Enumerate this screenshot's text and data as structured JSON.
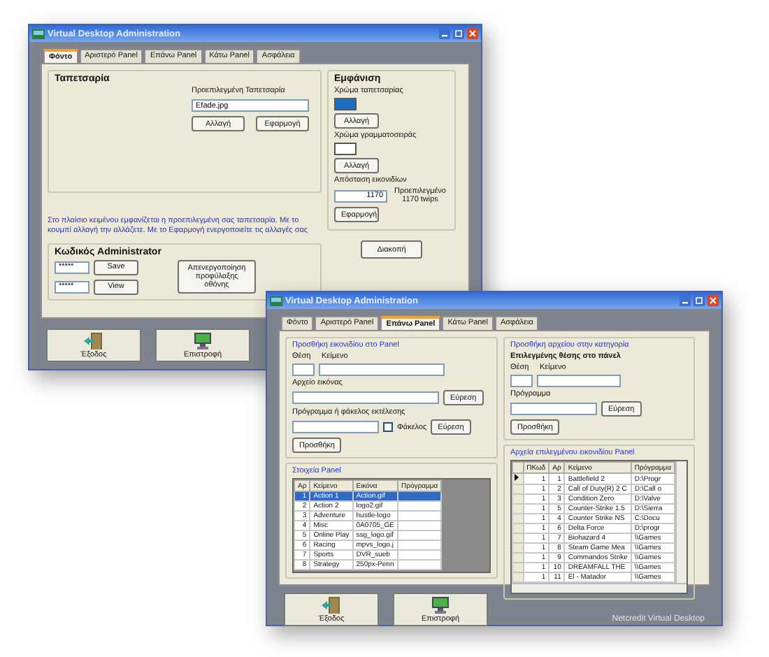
{
  "back_window": {
    "title": "Virtual Desktop Administration",
    "tabs": [
      {
        "label": "Φόντο",
        "selected": true
      },
      {
        "label": "Αριστερό Panel",
        "selected": false
      },
      {
        "label": "Επάνω Panel",
        "selected": false
      },
      {
        "label": "Κάτω Panel",
        "selected": false
      },
      {
        "label": "Ασφάλεια",
        "selected": false
      }
    ],
    "wallpaper_group": {
      "title": "Ταπετσαρία",
      "field_label": "Προεπιλεγμένη Ταπετσαρία",
      "field_value": "Efade.jpg",
      "buttons": [
        "Αλλαγή",
        "Εφαρμογή"
      ]
    },
    "note": "Στο πλαίσιο κειμένου εμφανίζεται η προεπιλεγμένη σας ταπετσαρία. Με το κουμπί αλλαγή την αλλάζετε. Με το Εφαρμογή ενεργοποιείτε τις αλλαγές σας",
    "password_group": {
      "title": "Κωδικός Administrator",
      "rows": [
        {
          "value": "*****",
          "button": "Save"
        },
        {
          "value": "*****",
          "button": "View"
        }
      ],
      "screensaver_button": "Απενεργοποίηση προφύλαξης οθόνης"
    },
    "appearance_group": {
      "title": "Εμφάνιση",
      "colors": [
        {
          "label": "Χρώμα ταπετσαρίας",
          "color": "#1a6fc4",
          "button": "Αλλαγή"
        },
        {
          "label": "Χρώμα γραμματοσειράς",
          "color": "#ffffff",
          "button": "Αλλαγή"
        }
      ],
      "spacing_label": "Απόσταση εικονιδίων",
      "spacing_value": "1170",
      "spacing_hint": "Προεπιλεγμένο 1170 twips",
      "apply_button": "Εφαρμογή"
    },
    "stop_button": "Διακοπή",
    "footer_buttons": [
      {
        "label": "Έξοδος",
        "kind": "exit"
      },
      {
        "label": "Επιστροφή",
        "kind": "return"
      }
    ]
  },
  "front_window": {
    "title": "Virtual Desktop Administration",
    "tabs": [
      {
        "label": "Φόντο",
        "selected": false
      },
      {
        "label": "Αριστερό Panel",
        "selected": false
      },
      {
        "label": "Επάνω Panel",
        "selected": true
      },
      {
        "label": "Κάτω Panel",
        "selected": false
      },
      {
        "label": "Ασφάλεια",
        "selected": false
      }
    ],
    "add_icon_group": {
      "title": "Προσθήκη εικονιδίου στο Panel",
      "position_label": "Θέση",
      "text_label": "Κείμενο",
      "image_label": "Αρχείο εικόνας",
      "image_browse_button": "Εύρεση",
      "program_label": "Πρόγραμμα ή φάκελος εκτέλεσης",
      "folder_checkbox": {
        "label": "Φάκελος",
        "checked": false
      },
      "program_browse_button": "Εύρεση",
      "add_button": "Προσθήκη"
    },
    "panel_items_group": {
      "title": "Στοιχεία Panel",
      "columns": [
        "Αρ",
        "Κείμενο",
        "Εικόνα",
        "Πρόγραμμα"
      ],
      "rows": [
        {
          "number": "1",
          "text": "Action 1",
          "image": "Action.gif",
          "selected": true
        },
        {
          "number": "2",
          "text": "Action 2",
          "image": "logo2.gif",
          "selected": false
        },
        {
          "number": "3",
          "text": "Adventure",
          "image": "hustle-logo",
          "selected": false
        },
        {
          "number": "4",
          "text": "Misc",
          "image": "0A0705_GE",
          "selected": false
        },
        {
          "number": "5",
          "text": "Online Play",
          "image": "ssg_logo.gif",
          "selected": false
        },
        {
          "number": "6",
          "text": "Racing",
          "image": "mpvs_logo.j",
          "selected": false
        },
        {
          "number": "7",
          "text": "Sports",
          "image": "DVR_sueb",
          "selected": false
        },
        {
          "number": "8",
          "text": "Strategy",
          "image": "250px-Penn",
          "selected": false
        }
      ]
    },
    "add_file_group": {
      "title": "Προσθήκη αρχείου στην κατηγορία",
      "subtitle": "Επιλεγμένης θέσης στο πάνελ",
      "position_label": "Θέση",
      "text_label": "Κείμενο",
      "program_label": "Πρόγραμμα",
      "browse_button": "Εύρεση",
      "add_button": "Προσθήκη"
    },
    "files_group": {
      "title": "Αρχεία επιλεγμένου εικονιδίου Panel",
      "columns": [
        "ΠΚωδ",
        "Αρ",
        "Κείμενο",
        "Πρόγραμμα"
      ],
      "rows": [
        {
          "code": "1",
          "number": "1",
          "text": "Battlefield 2",
          "program": "D:\\Progr",
          "current": true
        },
        {
          "code": "1",
          "number": "2",
          "text": "Call of Duty(R) 2 C",
          "program": "D:\\Call o",
          "current": false
        },
        {
          "code": "1",
          "number": "3",
          "text": "Condition Zero",
          "program": "D:\\Valve",
          "current": false
        },
        {
          "code": "1",
          "number": "5",
          "text": "Counter-Strike 1.5",
          "program": "D:\\Sierra",
          "current": false
        },
        {
          "code": "1",
          "number": "4",
          "text": "Counter Strike NS",
          "program": "C:\\Docu",
          "current": false
        },
        {
          "code": "1",
          "number": "6",
          "text": "Delta Force",
          "program": "D:\\progr",
          "current": false
        },
        {
          "code": "1",
          "number": "7",
          "text": "Biohazard 4",
          "program": "\\\\Games",
          "current": false
        },
        {
          "code": "1",
          "number": "8",
          "text": "Steam Game Mea",
          "program": "\\\\Games",
          "current": false
        },
        {
          "code": "1",
          "number": "9",
          "text": "Commandos Strike",
          "program": "\\\\Games",
          "current": false
        },
        {
          "code": "1",
          "number": "10",
          "text": "DREAMFALL THE",
          "program": "\\\\Games",
          "current": false
        },
        {
          "code": "1",
          "number": "11",
          "text": "El - Matador",
          "program": "\\\\Games",
          "current": false
        }
      ]
    },
    "footer_buttons": [
      {
        "label": "Έξοδος",
        "kind": "exit"
      },
      {
        "label": "Επιστροφή",
        "kind": "return"
      }
    ],
    "footer_text": "Netcredit Virtual Desktop"
  }
}
